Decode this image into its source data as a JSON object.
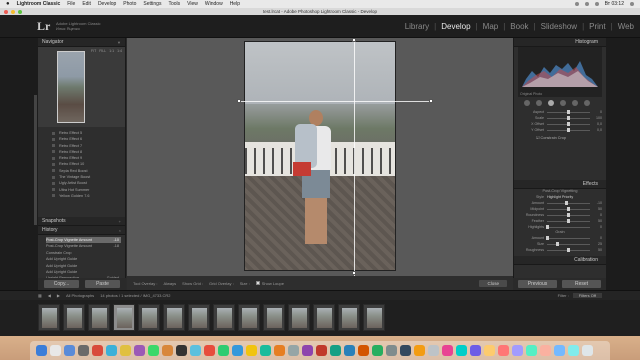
{
  "menubar": {
    "apple": "",
    "app": "Lightroom Classic",
    "items": [
      "File",
      "Edit",
      "Develop",
      "Photo",
      "Settings",
      "Tools",
      "View",
      "Window",
      "Help"
    ],
    "time": "Вт 03:12"
  },
  "window": {
    "title": "test.lrcat - Adobe Photoshop Lightroom Classic - Develop"
  },
  "identity": {
    "logo": "Lr",
    "line1": "Adobe Lightroom Classic",
    "line2": "Илья Яцечко"
  },
  "modules": [
    "Library",
    "Develop",
    "Map",
    "Book",
    "Slideshow",
    "Print",
    "Web"
  ],
  "modules_active": "Develop",
  "left_panel": {
    "navigator_label": "Navigator",
    "navigator_modes": [
      "FIT",
      "FILL",
      "1:1",
      "1:4"
    ],
    "presets": [
      "Retro Effect 5",
      "Retro Effect 6",
      "Retro Effect 7",
      "Retro Effect 8",
      "Retro Effect 9",
      "Retro Effect 10",
      "Sepia Red Boost",
      "The Vintage Boost",
      "Ugly Artist Boost",
      "Ultra Hot Summer",
      "Yellow Golden 7.6"
    ],
    "snapshots_label": "Snapshots",
    "history_label": "History",
    "history": [
      {
        "label": "Post-Crop Vignette Amount",
        "value": "-10",
        "selected": true
      },
      {
        "label": "Post-Crop Vignette Amount",
        "value": "-18",
        "selected": false
      },
      {
        "label": "Constrain Crop",
        "value": "",
        "selected": false
      },
      {
        "label": "Add Upright Guide",
        "value": "",
        "selected": false
      },
      {
        "label": "Add Upright Guide",
        "value": "",
        "selected": false
      },
      {
        "label": "Add Upright Guide",
        "value": "",
        "selected": false
      },
      {
        "label": "Upright Perspective",
        "value": "Guided",
        "selected": false
      }
    ],
    "copy_label": "Copy...",
    "paste_label": "Paste"
  },
  "toolbar": {
    "tool_overlay_label": "Tool Overlay :",
    "tool_overlay_value": "Always",
    "show_grid_label": "Show Grid :",
    "grid_overlay_label": "Grid Overlay :",
    "size_label": "Size :",
    "show_loupe_label": "Show Loupe",
    "close_label": "Close"
  },
  "right_panel": {
    "histogram_label": "Histogram",
    "histogram_meta": "Original Photo",
    "transform_sliders": [
      {
        "label": "Aspect",
        "value": "0",
        "pos": 0.5
      },
      {
        "label": "Scale",
        "value": "100",
        "pos": 0.5
      },
      {
        "label": "X Offset",
        "value": "0,0",
        "pos": 0.5
      },
      {
        "label": "Y Offset",
        "value": "0,0",
        "pos": 0.5
      }
    ],
    "constrain_label": "Constrain Crop",
    "effects_label": "Effects",
    "vignette_title": "Post-Crop Vignetting",
    "style_label": "Style",
    "style_value": "Highlight Priority",
    "vignette_sliders": [
      {
        "label": "Amount",
        "value": "-10",
        "pos": 0.45
      },
      {
        "label": "Midpoint",
        "value": "50",
        "pos": 0.5
      },
      {
        "label": "Roundness",
        "value": "0",
        "pos": 0.5
      },
      {
        "label": "Feather",
        "value": "50",
        "pos": 0.5
      },
      {
        "label": "Highlights",
        "value": "0",
        "pos": 0.0
      }
    ],
    "grain_label": "Grain",
    "grain_sliders": [
      {
        "label": "Amount",
        "value": "0",
        "pos": 0.0
      },
      {
        "label": "Size",
        "value": "25",
        "pos": 0.25
      },
      {
        "label": "Roughness",
        "value": "50",
        "pos": 0.5
      }
    ],
    "calibration_label": "Calibration",
    "previous_label": "Previous",
    "reset_label": "Reset"
  },
  "filmbar": {
    "source": "All Photographs",
    "info": "14 photos / 1 selected / IMG_4733.CR2",
    "filter_label": "Filter :",
    "filter_value": "Filters Off"
  },
  "filmstrip": {
    "count": 14,
    "selected_index": 3
  },
  "colors": {
    "accent": "#e8e8e8",
    "panel": "#2e2e2e",
    "canvas": "#595959",
    "dock": "#d4a984"
  }
}
